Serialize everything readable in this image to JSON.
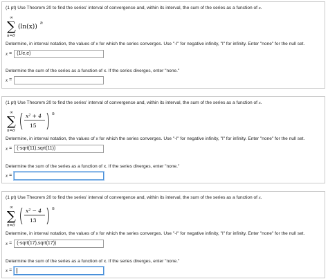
{
  "problems": [
    {
      "prompt_pre": "(1 pt) Use Theorem 20 to find the series' interval of convergence and, within its interval, the sum of the series as a function of ",
      "var": "x",
      "prompt_post": ".",
      "formula": {
        "sigma_top": "∞",
        "sigma_bottom": "n=0",
        "body": "(ln(x))",
        "exponent": "n"
      },
      "interval_question": "Determine, in interval notation, the values of x for which the series converges. Use \"-I\" for negative infinity, \"I\" for infinity. Enter \"none\" for the null set.",
      "interval_label": "x",
      "eq": "=",
      "interval_value": "(1/e,e)",
      "sum_question": "Determine the sum of the series as a function of x. If the series diverges, enter \"none.\"",
      "sum_label": "x",
      "sum_value": "",
      "sum_focused": false
    },
    {
      "prompt_pre": "(1 pt) Use Theorem 20 to find the series' interval of convergence and, within its interval, the sum of the series as a function of ",
      "var": "x",
      "prompt_post": ".",
      "formula": {
        "sigma_top": "∞",
        "sigma_bottom": "n=0",
        "numerator": "x² + 4",
        "denominator": "15",
        "exponent": "n"
      },
      "interval_question": "Determine, in interval notation, the values of x for which the series converges. Use \"-I\" for negative infinity, \"I\" for infinity. Enter \"none\" for the null set.",
      "interval_label": "x",
      "eq": "=",
      "interval_value": "(-sqrt(11),sqrt(11))",
      "sum_question": "Determine the sum of the series as a function of x. If the series diverges, enter \"none.\"",
      "sum_label": "x",
      "sum_value": "",
      "sum_focused": true
    },
    {
      "prompt_pre": "(1 pt) Use Theorem 20 to find the series' interval of convergence and, within its interval, the sum of the series as a function of ",
      "var": "x",
      "prompt_post": ".",
      "formula": {
        "sigma_top": "∞",
        "sigma_bottom": "n=0",
        "numerator": "x² − 4",
        "denominator": "13",
        "exponent": "n"
      },
      "interval_question": "Determine, in interval notation, the values of x for which the series converges. Use \"-I\" for negative infinity, \"I\" for infinity. Enter \"none\" for the null set.",
      "interval_label": "x",
      "eq": "=",
      "interval_value": "(-sqrt(17),sqrt(17))",
      "sum_question": "Determine the sum of the series as a function of x. If the series diverges, enter \"none.\"",
      "sum_label": "x",
      "sum_value": "",
      "sum_focused": true
    }
  ]
}
